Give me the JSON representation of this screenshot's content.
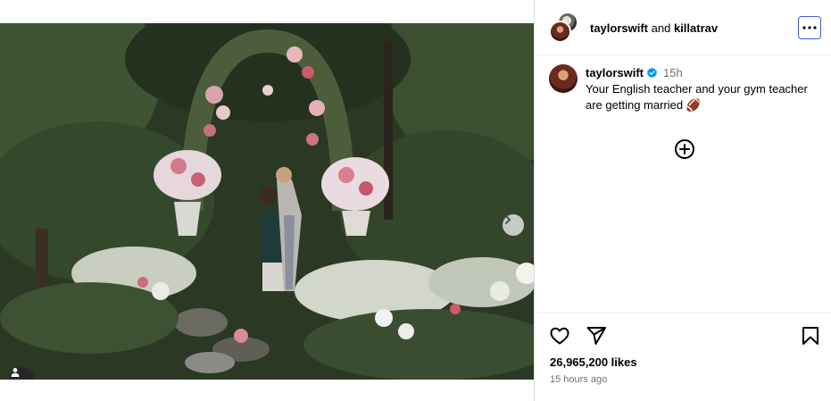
{
  "header": {
    "user_1": "taylorswift",
    "joiner": "and",
    "user_2": "killatrav"
  },
  "caption": {
    "username": "taylorswift",
    "age": "15h",
    "text": "Your English teacher and your gym teacher are getting married 🏈"
  },
  "stats": {
    "likes": "26,965,200 likes",
    "posted": "15 hours ago"
  },
  "icons": {
    "next": "chevron-right-icon",
    "tag": "user-tag-icon",
    "more": "more-options-icon",
    "verified": "verified-badge-icon",
    "load_comments": "plus-circle-icon",
    "like": "heart-icon",
    "share": "send-icon",
    "save": "bookmark-icon"
  },
  "colors": {
    "verified": "#0095f6",
    "muted": "#737373",
    "focus_outline": "#3b5bdb"
  }
}
